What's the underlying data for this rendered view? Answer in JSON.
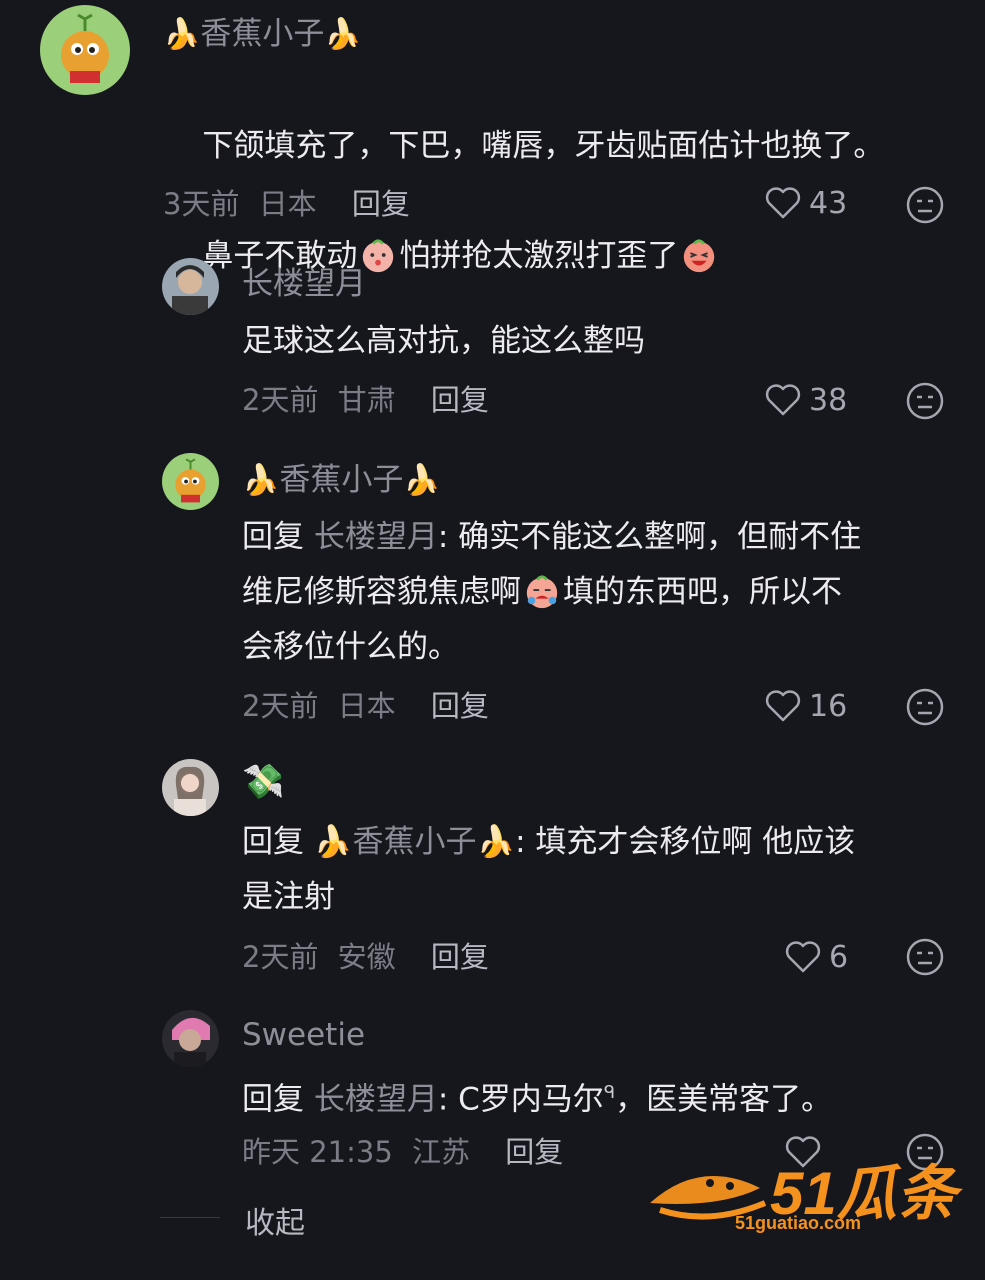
{
  "comments": [
    {
      "username": "香蕉小子",
      "emoji_left": "🍌",
      "emoji_right": "🍌",
      "text_line1": "下颌填充了，下巴，嘴唇，牙齿贴面估计也换了。",
      "text_line2a": "鼻子不敢动",
      "text_line2b": "怕拼抢太激烈打歪了",
      "time": "3天前",
      "location": "日本",
      "reply_label": "回复",
      "likes": "43"
    },
    {
      "username": "长楼望月",
      "text": "足球这么高对抗，能这么整吗",
      "time": "2天前",
      "location": "甘肃",
      "reply_label": "回复",
      "likes": "38"
    },
    {
      "username": "香蕉小子",
      "emoji_left": "🍌",
      "emoji_right": "🍌",
      "reply_prefix": "回复",
      "reply_target": "长楼望月",
      "text_a": ": 确实不能这么整啊，但耐不住",
      "text_b": "维尼修斯容貌焦虑啊",
      "text_c": "填的东西吧，所以不",
      "text_d": "会移位什么的。",
      "time": "2天前",
      "location": "日本",
      "reply_label": "回复",
      "likes": "16"
    },
    {
      "username": "💸",
      "reply_prefix": "回复",
      "reply_target": "香蕉小子",
      "reply_target_emoji": "🍌",
      "text_a": ": 填充才会移位啊 他应该",
      "text_b": "是注射",
      "time": "2天前",
      "location": "安徽",
      "reply_label": "回复",
      "likes": "6"
    },
    {
      "username": "Sweetie",
      "reply_prefix": "回复",
      "reply_target": "长楼望月",
      "text_a": ": C罗内马尔",
      "search_glyph": "ᑫ",
      "text_b": "，医美常客了。",
      "time": "昨天 21:35",
      "location": "江苏",
      "reply_label": "回复"
    }
  ],
  "collapse_label": "收起",
  "watermark": {
    "brand": "51瓜条",
    "url": "51guatiao.com"
  },
  "colors": {
    "background": "#16161d",
    "text": "#ececf0",
    "muted": "#8e8e98",
    "watermark": "#f5921e"
  }
}
